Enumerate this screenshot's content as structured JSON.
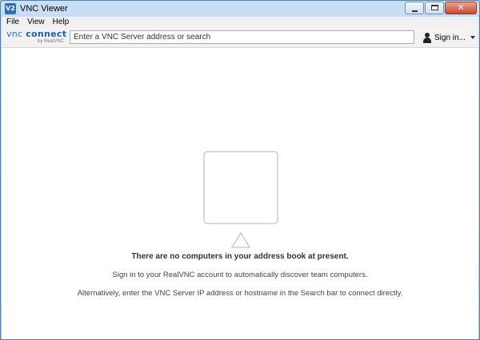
{
  "window": {
    "title": "VNC Viewer",
    "app_icon_text": "V2"
  },
  "menu": {
    "items": [
      "File",
      "View",
      "Help"
    ]
  },
  "toolbar": {
    "logo_main_left": "vnc ",
    "logo_main_right": "connect",
    "logo_sub": "by RealVNC",
    "search_placeholder": "Enter a VNC Server address or search",
    "signin_label": "Sign in..."
  },
  "empty_state": {
    "title": "There are no computers in your address book at present.",
    "line1": "Sign in to your RealVNC account to automatically discover team computers.",
    "line2": "Alternatively, enter the VNC Server IP address or hostname in the Search bar to connect directly."
  },
  "colors": {
    "accent": "#2a72c7",
    "close_button": "#c9472c"
  },
  "icons": {
    "app": "vnc-app-icon",
    "minimize": "minimize-icon",
    "maximize": "maximize-icon",
    "close": "close-icon",
    "account": "person-icon",
    "dropdown": "caret-down-icon",
    "empty": "monitor-icon"
  }
}
